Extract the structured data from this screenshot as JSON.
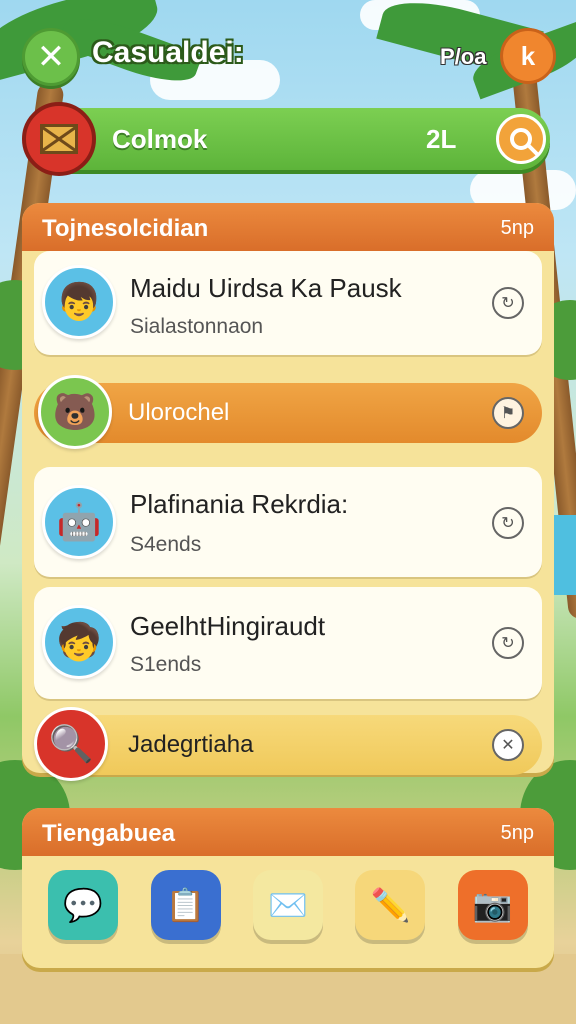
{
  "top_bar": {
    "close_symbol": "✕",
    "title": "Casualdei:",
    "right_label": "P/oa",
    "profile_symbol": "k"
  },
  "search_banner": {
    "label": "Colmok",
    "count": "2L"
  },
  "main_panel": {
    "title": "Tojnesolcidian",
    "right_label": "5np",
    "rows": [
      {
        "type": "card",
        "title": "Maidu Uirdsa Ka Pausk",
        "subtitle": "Sialastonnaon",
        "avatar_icon": "boy-avatar-icon",
        "action_icon": "refresh-icon"
      },
      {
        "type": "strip",
        "title": "Ulorochel",
        "avatar_icon": "bear-avatar-icon",
        "action_icon": "flag-icon"
      },
      {
        "type": "card",
        "title": "Plafinania Rekrdia:",
        "subtitle": "S4ends",
        "avatar_icon": "robot-avatar-icon",
        "action_icon": "refresh-icon"
      },
      {
        "type": "card",
        "title": "GeelhtHingiraudt",
        "subtitle": "S1ends",
        "avatar_icon": "cat-boy-avatar-icon",
        "action_icon": "refresh-icon"
      },
      {
        "type": "strip",
        "title": "Jadegrtiaha",
        "avatar_icon": "search-avatar-icon",
        "action_icon": "close-icon"
      }
    ]
  },
  "bottom_panel": {
    "title": "Tiengabuea",
    "right_label": "5np",
    "apps": [
      {
        "name": "chat-app-icon",
        "color": "#3bbfae"
      },
      {
        "name": "notes-app-icon",
        "color": "#3a6fd0"
      },
      {
        "name": "mail-app-icon",
        "color": "#f4e8a0"
      },
      {
        "name": "pencil-app-icon",
        "color": "#f6d77a"
      },
      {
        "name": "camera-app-icon",
        "color": "#ee6f2a"
      }
    ]
  }
}
